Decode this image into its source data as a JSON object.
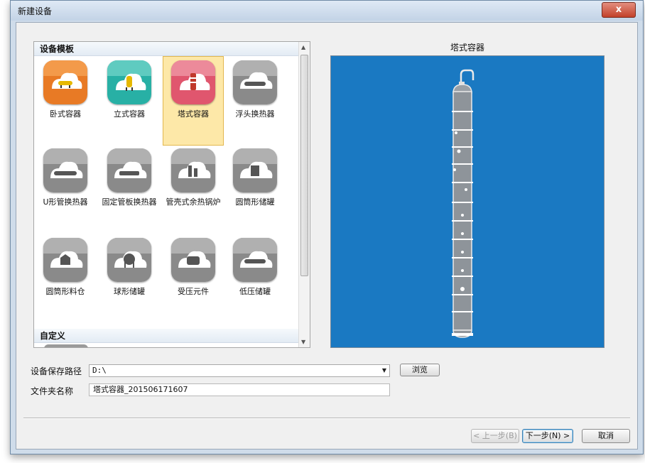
{
  "window": {
    "title": "新建设备",
    "close_label": "x"
  },
  "templates": {
    "group_header": "设备模板",
    "custom_header": "自定义",
    "items": [
      {
        "label": "卧式容器",
        "icon": "horizontal-vessel-icon",
        "color": "#e87a25"
      },
      {
        "label": "立式容器",
        "icon": "vertical-vessel-icon",
        "color": "#28b0a5"
      },
      {
        "label": "塔式容器",
        "icon": "tower-vessel-icon",
        "color": "#e0566e",
        "selected": true
      },
      {
        "label": "浮头换热器",
        "icon": "floating-head-exchanger-icon",
        "color": "#8a8a8a"
      },
      {
        "label": "U形管换热器",
        "icon": "u-tube-exchanger-icon",
        "color": "#8a8a8a"
      },
      {
        "label": "固定管板换热器",
        "icon": "fixed-tube-exchanger-icon",
        "color": "#8a8a8a"
      },
      {
        "label": "管壳式余热锅炉",
        "icon": "waste-heat-boiler-icon",
        "color": "#8a8a8a"
      },
      {
        "label": "圆筒形储罐",
        "icon": "cylindrical-tank-icon",
        "color": "#8a8a8a"
      },
      {
        "label": "圆筒形料仓",
        "icon": "cylindrical-silo-icon",
        "color": "#8a8a8a"
      },
      {
        "label": "球形储罐",
        "icon": "spherical-tank-icon",
        "color": "#8a8a8a"
      },
      {
        "label": "受压元件",
        "icon": "pressure-part-icon",
        "color": "#8a8a8a"
      },
      {
        "label": "低压储罐",
        "icon": "low-pressure-tank-icon",
        "color": "#8a8a8a"
      }
    ]
  },
  "preview": {
    "title": "塔式容器",
    "background": "#1a79c2"
  },
  "form": {
    "path_label": "设备保存路径",
    "path_value": "D:\\",
    "browse_label": "浏览",
    "folder_label": "文件夹名称",
    "folder_value": "塔式容器_201506171607"
  },
  "footer": {
    "prev_label": "< 上一步(B)",
    "next_label": "下一步(N) >",
    "cancel_label": "取消"
  }
}
